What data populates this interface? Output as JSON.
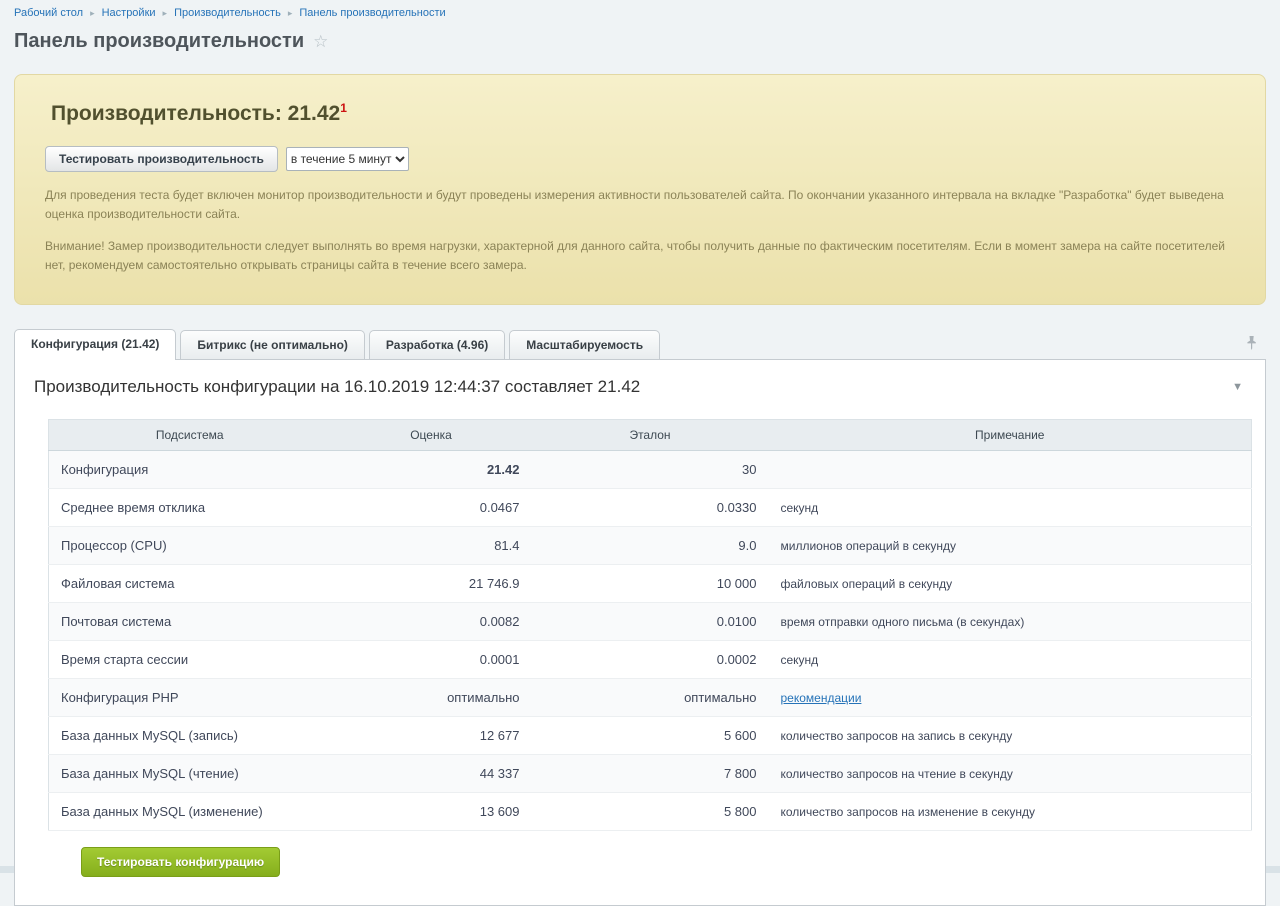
{
  "breadcrumb": {
    "items": [
      {
        "label": "Рабочий стол"
      },
      {
        "label": "Настройки"
      },
      {
        "label": "Производительность"
      },
      {
        "label": "Панель производительности"
      }
    ]
  },
  "page": {
    "title": "Панель производительности"
  },
  "perf_panel": {
    "heading_prefix": "Производительность: ",
    "heading_value": "21.42",
    "footnote_mark": "1",
    "test_button_label": "Тестировать производительность",
    "duration_selected": "в течение 5 минут",
    "desc1": "Для проведения теста будет включен монитор производительности и будут проведены измерения активности пользователей сайта. По окончании указанного интервала на вкладке \"Разработка\" будет выведена оценка производительности сайта.",
    "desc2": "Внимание! Замер производительности следует выполнять во время нагрузки, характерной для данного сайта, чтобы получить данные по фактическим посетителям. Если в момент замера на сайте посетителей нет, рекомендуем самостоятельно открывать страницы сайта в течение всего замера."
  },
  "tabs": [
    {
      "label": "Конфигурация (21.42)",
      "active": true
    },
    {
      "label": "Битрикс (не оптимально)",
      "active": false
    },
    {
      "label": "Разработка (4.96)",
      "active": false
    },
    {
      "label": "Масштабируемость",
      "active": false
    }
  ],
  "config_section": {
    "title": "Производительность конфигурации на 16.10.2019 12:44:37 составляет 21.42",
    "table": {
      "headers": [
        "Подсистема",
        "Оценка",
        "Эталон",
        "Примечание"
      ],
      "rows": [
        {
          "name": "Конфигурация",
          "value": "21.42",
          "etalon": "30",
          "note": "",
          "value_bold": true,
          "note_link": false
        },
        {
          "name": "Среднее время отклика",
          "value": "0.0467",
          "etalon": "0.0330",
          "note": "секунд",
          "value_bold": false,
          "note_link": false
        },
        {
          "name": "Процессор (CPU)",
          "value": "81.4",
          "etalon": "9.0",
          "note": "миллионов операций в секунду",
          "value_bold": false,
          "note_link": false
        },
        {
          "name": "Файловая система",
          "value": "21 746.9",
          "etalon": "10 000",
          "note": "файловых операций в секунду",
          "value_bold": false,
          "note_link": false
        },
        {
          "name": "Почтовая система",
          "value": "0.0082",
          "etalon": "0.0100",
          "note": "время отправки одного письма (в секундах)",
          "value_bold": false,
          "note_link": false
        },
        {
          "name": "Время старта сессии",
          "value": "0.0001",
          "etalon": "0.0002",
          "note": "секунд",
          "value_bold": false,
          "note_link": false
        },
        {
          "name": "Конфигурация PHP",
          "value": "оптимально",
          "etalon": "оптимально",
          "note": "рекомендации",
          "value_bold": false,
          "note_link": true
        },
        {
          "name": "База данных MySQL (запись)",
          "value": "12 677",
          "etalon": "5 600",
          "note": "количество запросов на запись в секунду",
          "value_bold": false,
          "note_link": false
        },
        {
          "name": "База данных MySQL (чтение)",
          "value": "44 337",
          "etalon": "7 800",
          "note": "количество запросов на чтение в секунду",
          "value_bold": false,
          "note_link": false
        },
        {
          "name": "База данных MySQL (изменение)",
          "value": "13 609",
          "etalon": "5 800",
          "note": "количество запросов на изменение в секунду",
          "value_bold": false,
          "note_link": false
        }
      ]
    },
    "test_config_button_label": "Тестировать конфигурацию"
  }
}
